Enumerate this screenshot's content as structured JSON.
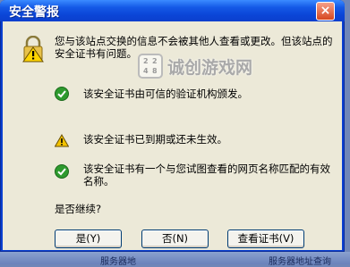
{
  "dialog": {
    "title": "安全警报",
    "close_glyph": "×",
    "intro_text": "您与该站点交换的信息不会被其他人查看或更改。但该站点的安全证书有问题。",
    "checks": [
      {
        "status": "ok",
        "icon": "green-check-icon",
        "text": "该安全证书由可信的验证机构颁发。"
      },
      {
        "status": "warning",
        "icon": "yellow-warning-icon",
        "text": "该安全证书已到期或还未生效。"
      },
      {
        "status": "ok",
        "icon": "green-check-icon",
        "text": "该安全证书有一个与您试图查看的网页名称匹配的有效名称。"
      }
    ],
    "question": "是否继续?",
    "buttons": {
      "yes": "是(Y)",
      "no": "否(N)",
      "view_cert": "查看证书(V)"
    }
  },
  "watermark": {
    "logo_digits": [
      "2",
      "2",
      "4",
      "8"
    ],
    "text": "诚创游戏网"
  },
  "taskbar": {
    "items": [
      "服务器地",
      "服务器地址查询"
    ]
  },
  "colors": {
    "titlebar": "#0b45d7",
    "client_bg": "#ece9d8",
    "close_button": "#d6471f",
    "check_green": "#2e9a2e",
    "warning_yellow": "#f2c200"
  }
}
